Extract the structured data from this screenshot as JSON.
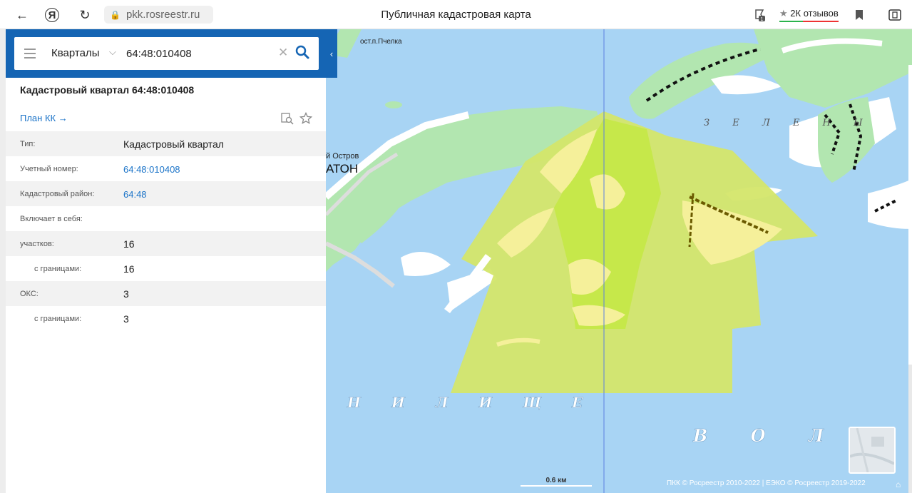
{
  "browser": {
    "url": "pkk.rosreestr.ru",
    "title": "Публичная кадастровая карта",
    "reviews": "2К отзывов",
    "tab_count": "1"
  },
  "search": {
    "layer": "Кварталы",
    "query": "64:48:010408"
  },
  "card": {
    "title": "Кадастровый квартал 64:48:010408",
    "plan_link": "План КК →",
    "rows": [
      {
        "key": "Тип:",
        "value": "Кадастровый квартал"
      },
      {
        "key": "Учетный номер:",
        "value": "64:48:010408"
      },
      {
        "key": "Кадастровый район:",
        "value": "64:48"
      },
      {
        "key": "Включает в себя:",
        "value": ""
      },
      {
        "key": "участков:",
        "value": "16"
      },
      {
        "key": "с границами:",
        "value": "16"
      },
      {
        "key": "ОКС:",
        "value": "3"
      },
      {
        "key": "с границами:",
        "value": "3"
      }
    ]
  },
  "map": {
    "scale": "0.6 км",
    "copyright": "ПКК © Росреестр 2010-2022 | ЕЭКО © Росреестр 2019-2022",
    "labels": {
      "village": "АТОН",
      "village_prefix": "й Остров",
      "stop": "ост.п.Пчелка",
      "river_1": "Н И Л И Щ Е",
      "river_2": "В О Л Г О",
      "island": "З Е Л Е Н Ы"
    },
    "colors": {
      "water": "#a8d4f4",
      "land": "#b2e6b0",
      "parcel": "#d4f060",
      "sand": "#f5f09a"
    }
  }
}
